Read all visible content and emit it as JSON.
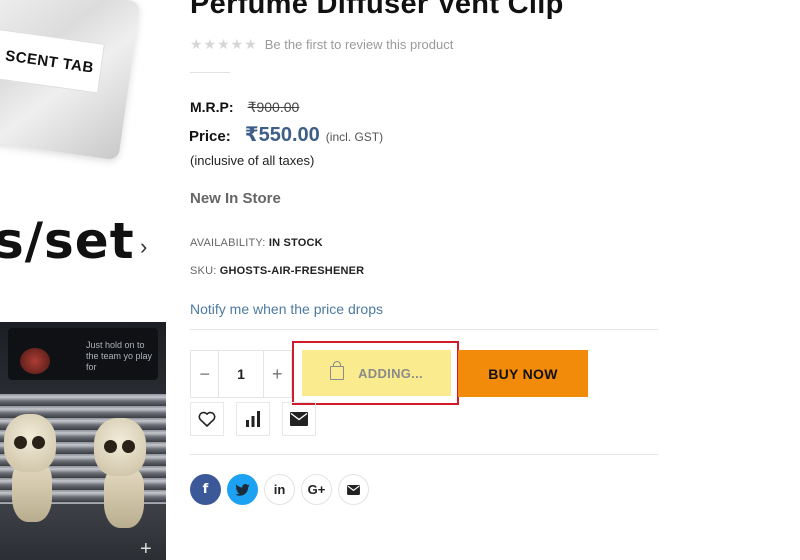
{
  "gallery": {
    "pouch_label": "SCENT TAB",
    "set_text": "s/set",
    "next_glyph": "›",
    "screen_text": "Just hold on to the team yo play for",
    "zoom_glyph": "+"
  },
  "product": {
    "title": "Perfume Diffuser Vent Clip",
    "stars": "★★★★★",
    "review_link": "Be the first to review this product",
    "mrp_label": "M.R.P:",
    "mrp_value": "₹900.00",
    "price_label": "Price:",
    "price_value": "₹550.00",
    "price_note": "(incl. GST)",
    "tax_note": "(inclusive of all taxes)",
    "stock_heading": "New In Store",
    "availability_label": "AVAILABILITY:",
    "availability_value": "IN STOCK",
    "sku_label": "SKU:",
    "sku_value": "GHOSTS-AIR-FRESHENER",
    "notify_link": "Notify me when the price drops"
  },
  "cart": {
    "minus": "−",
    "quantity": "1",
    "plus": "+",
    "add_label": "ADDING...",
    "buy_label": "BUY NOW"
  },
  "actions": [
    "wishlist-icon",
    "compare-icon",
    "email-icon"
  ],
  "share": {
    "facebook": "f",
    "twitter": "twitter-icon",
    "linkedin": "in",
    "googleplus": "G+",
    "email": "email-icon"
  },
  "colors": {
    "price": "#3d5f87",
    "add_button": "#fbeb8f",
    "buy_button": "#f28a0a",
    "highlight": "#d11a2a",
    "facebook": "#3b5998",
    "twitter": "#1da1f2",
    "notify_link": "#4c7aa0"
  }
}
